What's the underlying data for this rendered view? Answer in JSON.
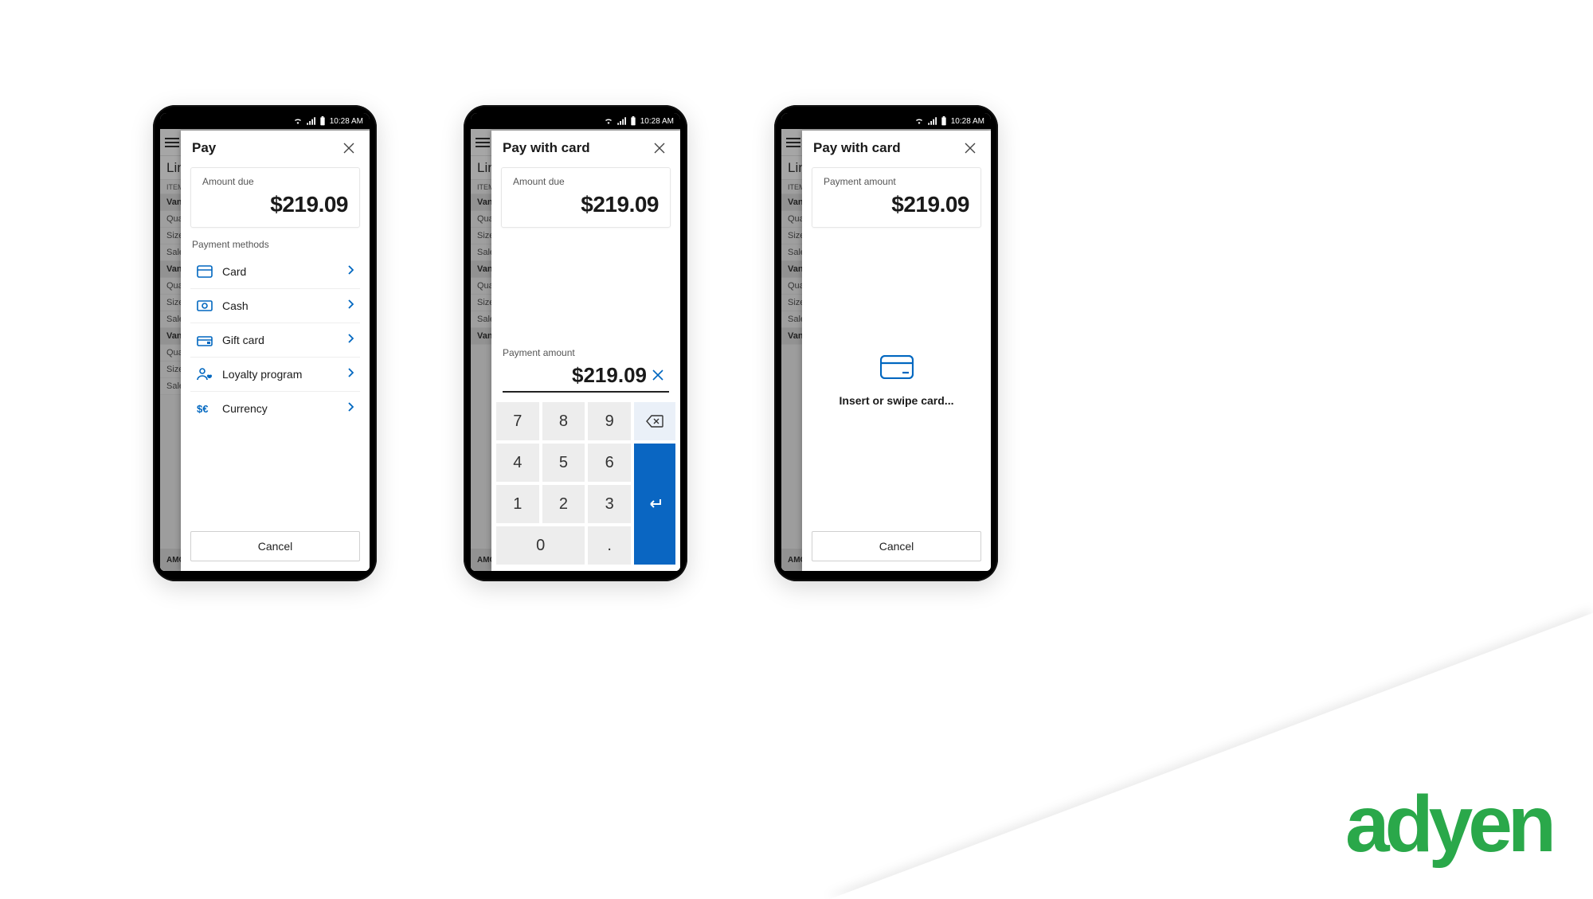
{
  "status_time": "10:28 AM",
  "background": {
    "title": "Lin",
    "sub": "ITEM",
    "group": "VanA",
    "line1": "Quan",
    "line2": "Size:",
    "line3": "Sales",
    "footer": "AMO"
  },
  "phone1": {
    "title": "Pay",
    "amount_label": "Amount due",
    "amount_value": "$219.09",
    "section": "Payment methods",
    "methods": [
      {
        "label": "Card",
        "icon": "card"
      },
      {
        "label": "Cash",
        "icon": "cash"
      },
      {
        "label": "Gift card",
        "icon": "gift"
      },
      {
        "label": "Loyalty program",
        "icon": "loyalty"
      },
      {
        "label": "Currency",
        "icon": "currency"
      }
    ],
    "cancel": "Cancel"
  },
  "phone2": {
    "title": "Pay with card",
    "amount_label": "Amount due",
    "amount_value": "$219.09",
    "pa_label": "Payment amount",
    "pa_value": "$219.09",
    "keys": [
      "7",
      "8",
      "9",
      "4",
      "5",
      "6",
      "1",
      "2",
      "3",
      "0",
      "."
    ]
  },
  "phone3": {
    "title": "Pay with card",
    "amount_label": "Payment amount",
    "amount_value": "$219.09",
    "prompt": "Insert or swipe card...",
    "cancel": "Cancel"
  },
  "brand": "adyen"
}
